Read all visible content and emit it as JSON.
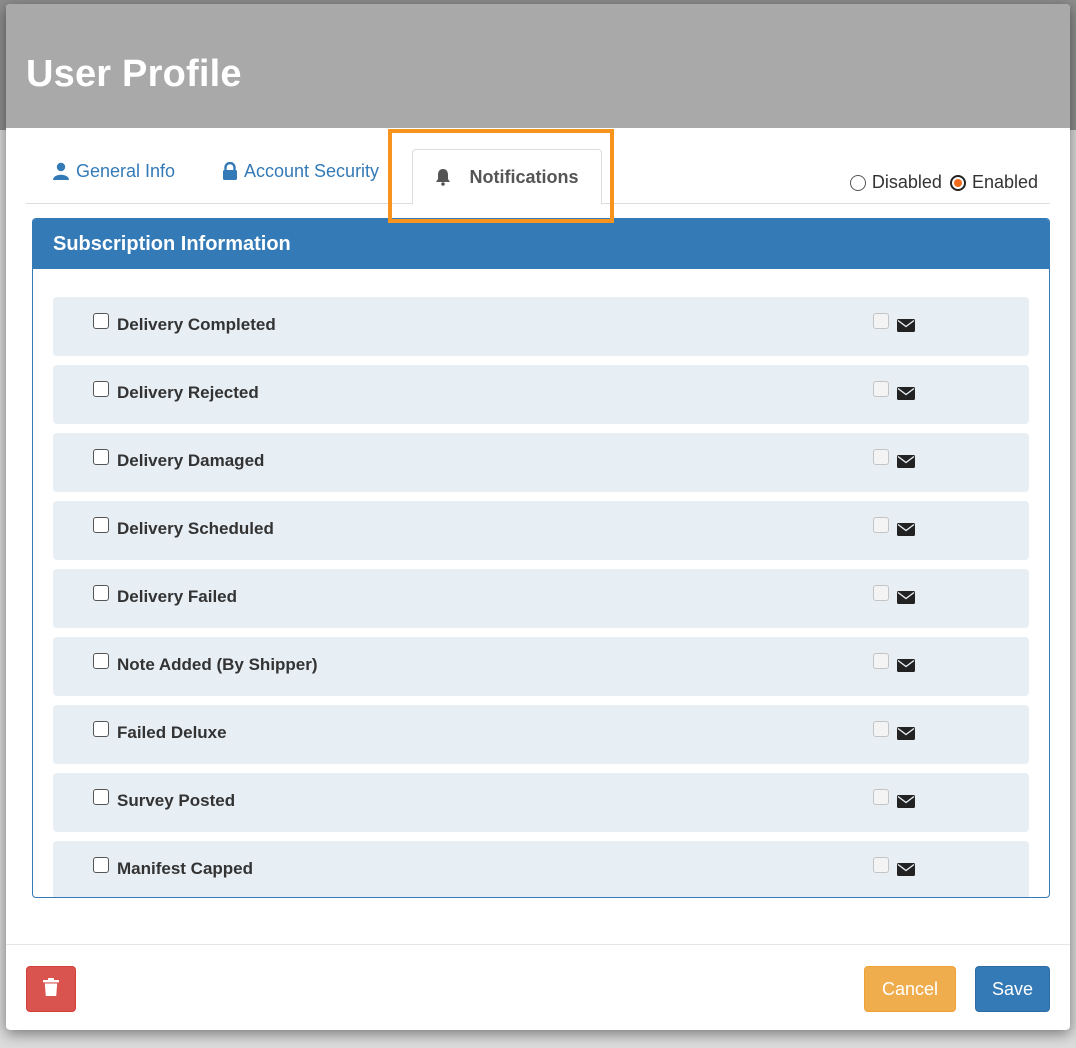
{
  "modal": {
    "title": "User Profile"
  },
  "tabs": [
    {
      "label": "General Info",
      "icon": "user-icon"
    },
    {
      "label": "Account Security",
      "icon": "lock-icon"
    },
    {
      "label": "Notifications",
      "icon": "bell-icon",
      "active": true
    }
  ],
  "status": {
    "disabled_label": "Disabled",
    "enabled_label": "Enabled",
    "selected": "Enabled"
  },
  "panel": {
    "heading": "Subscription Information",
    "items": [
      {
        "label": "Delivery Completed"
      },
      {
        "label": "Delivery Rejected"
      },
      {
        "label": "Delivery Damaged"
      },
      {
        "label": "Delivery Scheduled"
      },
      {
        "label": "Delivery Failed"
      },
      {
        "label": "Note Added (By Shipper)"
      },
      {
        "label": "Failed Deluxe"
      },
      {
        "label": "Survey Posted"
      },
      {
        "label": "Manifest Capped"
      }
    ]
  },
  "footer": {
    "delete_icon": "trash-icon",
    "cancel_label": "Cancel",
    "save_label": "Save"
  },
  "colors": {
    "primary": "#337ab7",
    "warning": "#f0ad4e",
    "danger": "#d9534f",
    "highlight": "#f7941d"
  }
}
